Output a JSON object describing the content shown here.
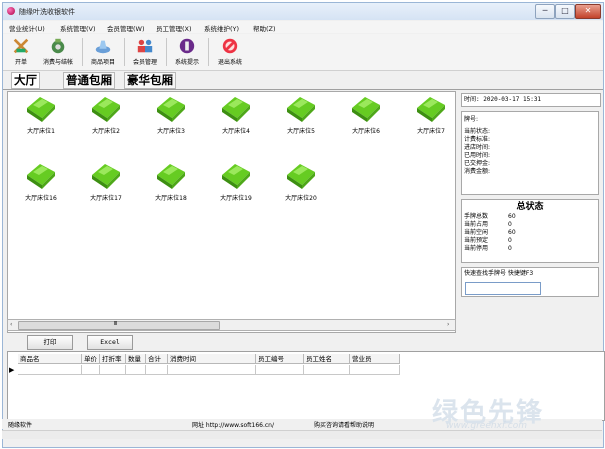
{
  "window": {
    "title": "随缘叶洗收银软件",
    "minimize": "─",
    "maximize": "□",
    "close": "✕"
  },
  "menu": [
    "营业统计(U)",
    "系统管理(V)",
    "会员管理(W)",
    "员工管理(X)",
    "系统维护(Y)",
    "帮助(Z)"
  ],
  "toolbar": [
    {
      "label": "开单",
      "icon": "open-order-icon"
    },
    {
      "label": "消费与结帐",
      "icon": "checkout-icon"
    },
    {
      "label": "商品项目",
      "icon": "products-icon"
    },
    {
      "label": "会员管理",
      "icon": "members-icon"
    },
    {
      "label": "系统提示",
      "icon": "system-tip-icon"
    },
    {
      "label": "退出系统",
      "icon": "exit-icon"
    }
  ],
  "room_tabs": [
    "大厅",
    "普通包厢",
    "豪华包厢"
  ],
  "beds": [
    "大厅床位1",
    "大厅床位2",
    "大厅床位3",
    "大厅床位4",
    "大厅床位5",
    "大厅床位6",
    "大厅床位7",
    "大厅床位16",
    "大厅床位17",
    "大厅床位18",
    "大厅床位19",
    "大厅床位20"
  ],
  "side": {
    "time_label": "时间:",
    "time_value": "2020-03-17 15:31",
    "detail_labels": [
      "牌号:",
      "当前状态:",
      "计费标准:",
      "进店时间:",
      "已用时间:",
      "已交押金:",
      "消费金额:"
    ],
    "status_title": "总状态",
    "status_rows": [
      {
        "label": "手牌总数",
        "value": "60"
      },
      {
        "label": "当前占用",
        "value": "0"
      },
      {
        "label": "当前空闲",
        "value": "60"
      },
      {
        "label": "当前预定",
        "value": "0"
      },
      {
        "label": "当前停用",
        "value": "0"
      }
    ],
    "search_label": "快速查找手牌号   快捷键F3",
    "search_value": ""
  },
  "scroll": {
    "thumb_label": "Ⅲ",
    "left": "‹",
    "right": "›"
  },
  "actions": {
    "print": "打印",
    "excel": "Excel"
  },
  "table": {
    "columns": [
      "商品名",
      "单价",
      "打折率",
      "数量",
      "合计",
      "消费时间",
      "员工编号",
      "员工姓名",
      "营业员"
    ],
    "row_indicator": "▶"
  },
  "statusbar": {
    "left": "随缘软件",
    "url": "网址 http://www.soft166.cn/",
    "note": "购买咨询请看帮助说明"
  },
  "watermark": {
    "cn": "绿色先锋",
    "en": "www.greenxf.com"
  },
  "colors": {
    "bed_green": "#66cc22",
    "panel_border": "#a8a8a8"
  }
}
